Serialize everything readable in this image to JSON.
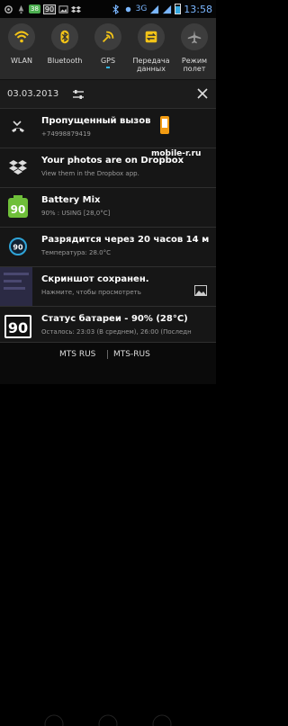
{
  "status_bar": {
    "badge_green": "38",
    "badge_num": "90",
    "network": "3G",
    "time": "13:58"
  },
  "quick_toggles": [
    {
      "label": "WLAN",
      "icon": "wifi-icon",
      "color": "#f2c318"
    },
    {
      "label": "Bluetooth",
      "icon": "bluetooth-icon",
      "color": "#f2c318"
    },
    {
      "label": "GPS",
      "icon": "gps-icon",
      "color": "#f2c318"
    },
    {
      "label": "Передача данных",
      "icon": "data-transfer-icon",
      "color": "#f2c318"
    },
    {
      "label": "Режим полет",
      "icon": "airplane-icon",
      "color": "#9a9a9a"
    }
  ],
  "header": {
    "date": "03.03.2013"
  },
  "notifications": [
    {
      "title": "Пропущенный вызов",
      "subtitle": "+74998879419",
      "icon": "missed-call-icon"
    },
    {
      "title": "Your photos are on Dropbox",
      "subtitle": "View them in the Dropbox app.",
      "icon": "dropbox-icon"
    },
    {
      "title": "Battery Mix",
      "subtitle": "90% : USING [28,0°C]",
      "icon": "battery-mix-icon",
      "icon_value": "90"
    },
    {
      "title": "Разрядится через 20 часов 14 м",
      "subtitle": "Температура: 28.0°C",
      "icon": "battery-round-icon",
      "icon_value": "90"
    },
    {
      "title": "Скриншот сохранен.",
      "subtitle": "Нажмите, чтобы просмотреть",
      "icon": "screenshot-icon"
    },
    {
      "title": "Статус батареи - 90% (28°C)",
      "subtitle": "Осталось: 23:03 (В среднем), 26:00 (Последн",
      "icon": "battery-status-icon",
      "icon_value": "90"
    }
  ],
  "watermark": "mobile-review.com",
  "carriers": [
    "MTS RUS",
    "MTS-RUS"
  ]
}
